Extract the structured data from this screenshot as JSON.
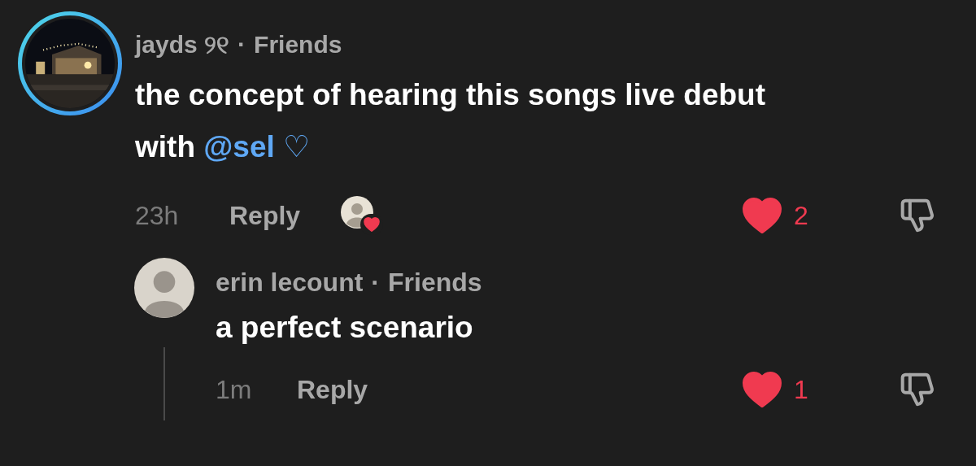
{
  "comment": {
    "author": "jayds ୨୧",
    "separator": "·",
    "relation": "Friends",
    "text": "the concept of hearing this songs live debut with",
    "mention": "@sel",
    "suffix": "♡",
    "time": "23h",
    "reply": "Reply",
    "creator_liked": true,
    "liked": true,
    "likes": "2",
    "disliked": false
  },
  "replies": [
    {
      "avatar": {
        "kind": "person"
      },
      "author": "erin lecount",
      "separator": "·",
      "relation": "Friends",
      "text": "a perfect scenario",
      "time": "1m",
      "reply": "Reply",
      "creator_liked": false,
      "liked": true,
      "likes": "1",
      "disliked": false
    }
  ]
}
